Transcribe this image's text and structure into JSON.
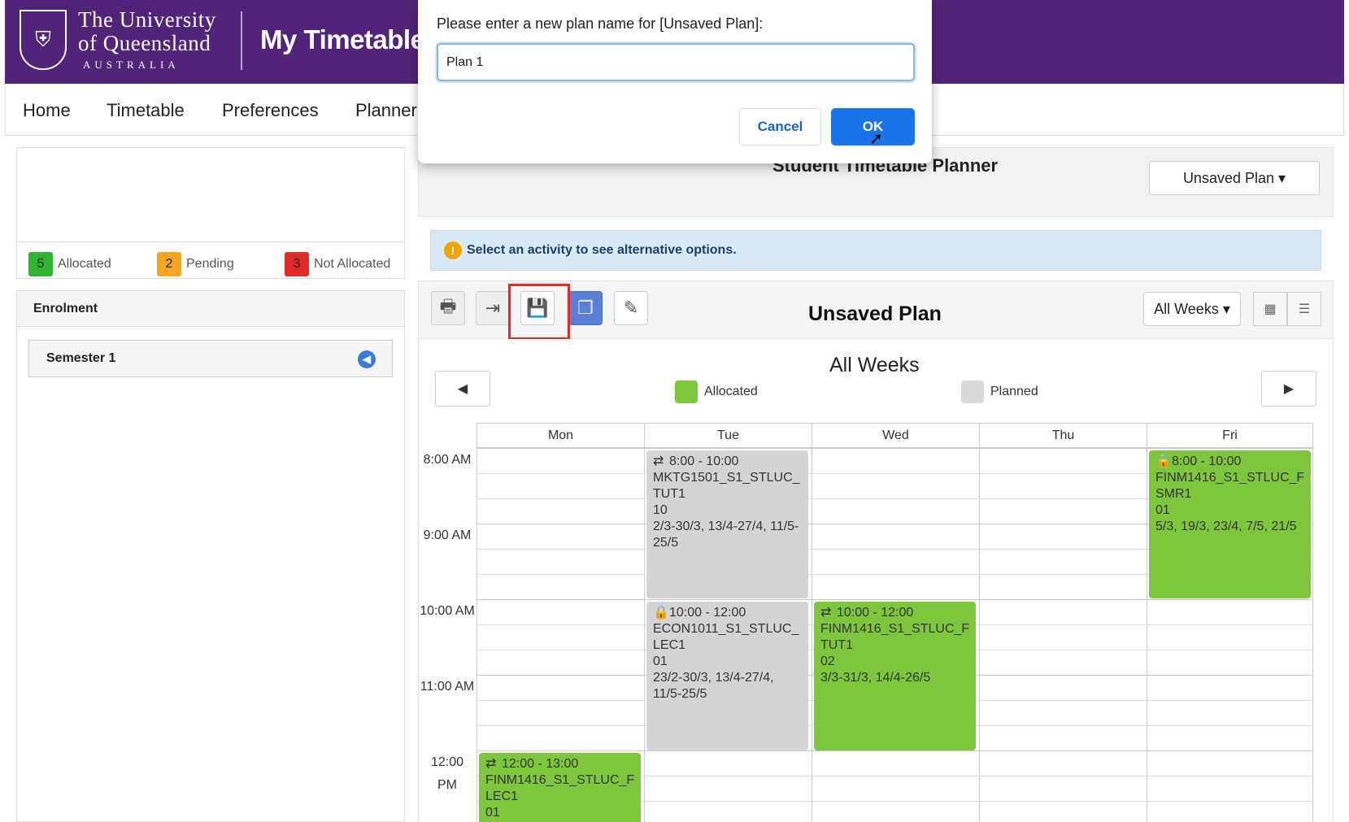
{
  "header": {
    "university_line1": "The University",
    "university_line2": "of Queensland",
    "university_line3": "AUSTRALIA",
    "app_title": "My Timetable"
  },
  "nav": {
    "items": [
      "Home",
      "Timetable",
      "Preferences",
      "Planner"
    ]
  },
  "status": {
    "allocated_count": "5",
    "allocated_label": "Allocated",
    "pending_count": "2",
    "pending_label": "Pending",
    "not_allocated_count": "3",
    "not_allocated_label": "Not Allocated",
    "colors": {
      "allocated": "#2fb52f",
      "pending": "#f5a623",
      "not_allocated": "#e02b2b"
    }
  },
  "enrolment": {
    "heading": "Enrolment",
    "semester": "Semester 1"
  },
  "planner": {
    "title": "Student Timetable Planner",
    "plan_dropdown": "Unsaved Plan ▾",
    "info_message": "Select an activity to see alternative options.",
    "plan_name": "Unsaved Plan",
    "weeks_dropdown": "All Weeks ▾",
    "weeks_title": "All Weeks",
    "legend_allocated": "Allocated",
    "legend_planned": "Planned"
  },
  "calendar": {
    "days": [
      "Mon",
      "Tue",
      "Wed",
      "Thu",
      "Fri"
    ],
    "times": [
      "8:00 AM",
      "9:00 AM",
      "10:00 AM",
      "11:00 AM",
      "12:00 PM"
    ],
    "events": [
      {
        "time": "8:00 - 10:00",
        "code": "MKTG1501_S1_STLUC_",
        "type": "TUT1",
        "group": "10",
        "weeks": "2/3-30/3, 13/4-27/4, 11/5-25/5",
        "icon": "swap-icon"
      },
      {
        "time": "10:00 - 12:00",
        "code": "ECON1011_S1_STLUC_",
        "type": "LEC1",
        "group": "01",
        "weeks": "23/2-30/3, 13/4-27/4, 11/5-25/5",
        "icon": "lock-icon"
      },
      {
        "time": "10:00 - 12:00",
        "code": "FINM1416_S1_STLUC_F",
        "type": "TUT1",
        "group": "02",
        "weeks": "3/3-31/3, 14/4-26/5",
        "icon": "swap-icon"
      },
      {
        "time": "8:00 - 10:00",
        "code": "FINM1416_S1_STLUC_F",
        "type": "SMR1",
        "group": "01",
        "weeks": "5/3, 19/3, 23/4, 7/5, 21/5",
        "icon": "lock-icon"
      },
      {
        "time": "12:00 - 13:00",
        "code": "FINM1416_S1_STLUC_F",
        "type": "LEC1",
        "group": "01",
        "icon": "swap-icon"
      }
    ],
    "colors": {
      "allocated": "#7ec63c",
      "planned": "#d4d4d4"
    }
  },
  "dialog": {
    "message": "Please enter a new plan name for [Unsaved Plan]:",
    "input_value": "Plan 1",
    "cancel_label": "Cancel",
    "ok_label": "OK"
  }
}
